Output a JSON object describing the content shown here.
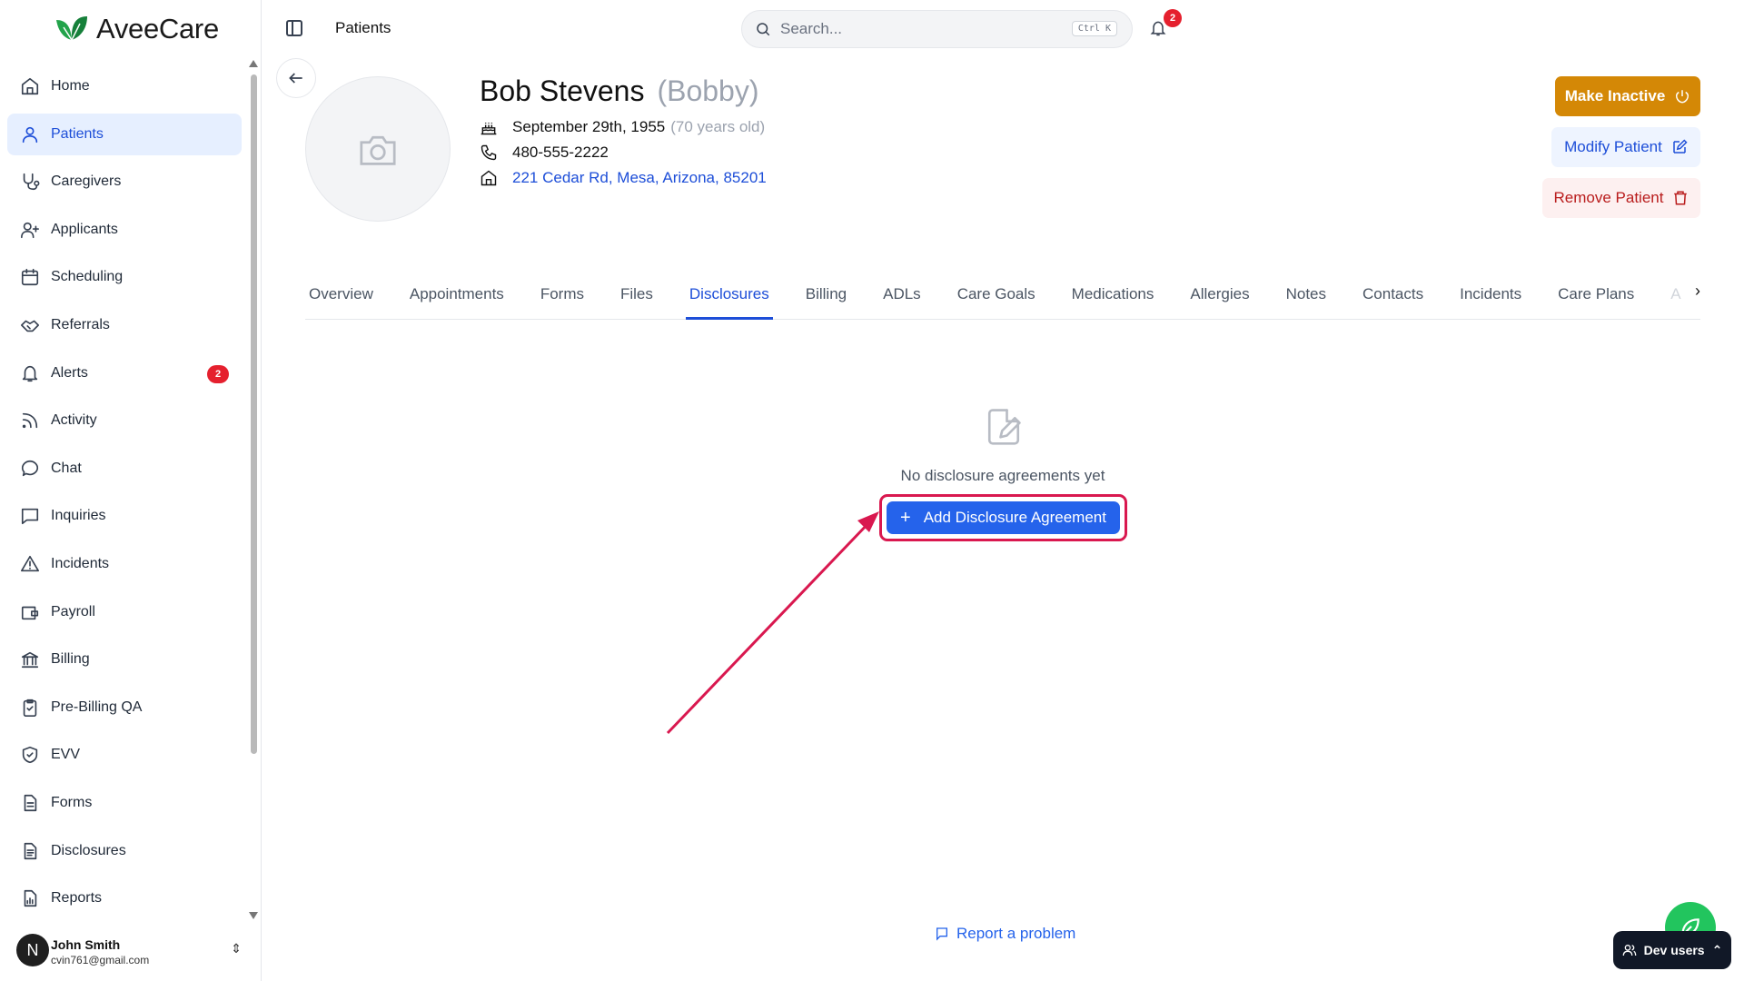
{
  "app": {
    "name": "AveeCare",
    "brand_color": "#22a34a"
  },
  "sidebar": {
    "items": [
      {
        "label": "Home",
        "icon": "home-icon"
      },
      {
        "label": "Patients",
        "icon": "user-icon",
        "active": true
      },
      {
        "label": "Caregivers",
        "icon": "stethoscope-icon"
      },
      {
        "label": "Applicants",
        "icon": "user-plus-icon"
      },
      {
        "label": "Scheduling",
        "icon": "calendar-icon"
      },
      {
        "label": "Referrals",
        "icon": "handshake-icon"
      },
      {
        "label": "Alerts",
        "icon": "bell-icon",
        "badge": "2"
      },
      {
        "label": "Activity",
        "icon": "rss-icon"
      },
      {
        "label": "Chat",
        "icon": "chat-bubble-icon"
      },
      {
        "label": "Inquiries",
        "icon": "message-square-icon"
      },
      {
        "label": "Incidents",
        "icon": "warning-triangle-icon"
      },
      {
        "label": "Payroll",
        "icon": "wallet-icon"
      },
      {
        "label": "Billing",
        "icon": "bank-icon"
      },
      {
        "label": "Pre-Billing QA",
        "icon": "clipboard-check-icon"
      },
      {
        "label": "EVV",
        "icon": "shield-check-icon"
      },
      {
        "label": "Forms",
        "icon": "file-text-icon"
      },
      {
        "label": "Disclosures",
        "icon": "file-list-icon"
      },
      {
        "label": "Reports",
        "icon": "file-chart-icon"
      }
    ],
    "user": {
      "initial": "N",
      "name": "John Smith",
      "email": "cvin761@gmail.com"
    }
  },
  "topbar": {
    "breadcrumb": "Patients",
    "search_placeholder": "Search...",
    "search_shortcut": "Ctrl K",
    "notifications_count": "2"
  },
  "patient": {
    "name": "Bob Stevens",
    "nickname": "(Bobby)",
    "dob": "September 29th, 1955",
    "age": "(70 years old)",
    "phone": "480-555-2222",
    "address": "221 Cedar Rd, Mesa, Arizona, 85201"
  },
  "actions": {
    "make_inactive": "Make Inactive",
    "modify": "Modify Patient",
    "remove": "Remove Patient"
  },
  "tabs": [
    "Overview",
    "Appointments",
    "Forms",
    "Files",
    "Disclosures",
    "Billing",
    "ADLs",
    "Care Goals",
    "Medications",
    "Allergies",
    "Notes",
    "Contacts",
    "Incidents",
    "Care Plans",
    "A"
  ],
  "active_tab": "Disclosures",
  "empty_state": {
    "message": "No disclosure agreements yet",
    "add_button": "Add Disclosure Agreement"
  },
  "footer": {
    "report_problem": "Report a problem",
    "dev_users": "Dev users"
  }
}
